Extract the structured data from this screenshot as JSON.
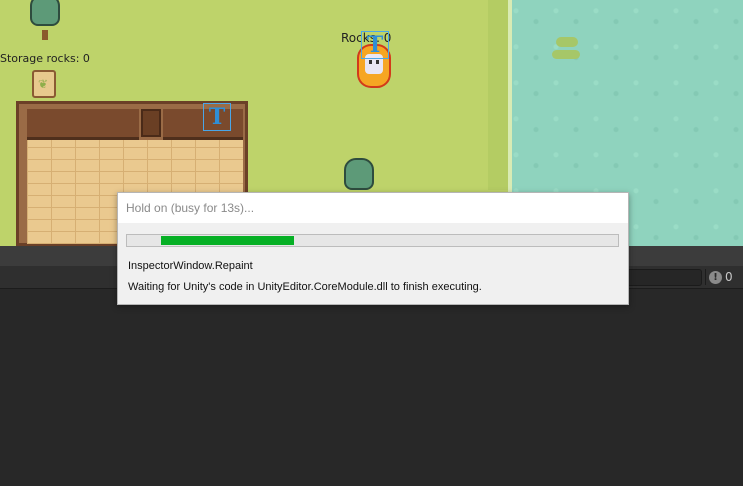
{
  "game": {
    "storage_label": "Storage rocks: 0",
    "rocks_label": "Rocks: 0",
    "gizmo_letter": "T",
    "sign_glyph": "❦"
  },
  "console": {
    "warning_icon": "!",
    "warning_count": "0"
  },
  "dialog": {
    "title": "Hold on (busy for 13s)...",
    "task": "InspectorWindow.Repaint",
    "message": "Waiting for Unity's code in UnityEditor.CoreModule.dll to finish executing.",
    "progress": 0.27,
    "progress_offset": 0.07,
    "progress_color": "#06b025"
  },
  "colors": {
    "grass": "#bed36a",
    "water": "#8fd3be",
    "editor_bg": "#282828"
  },
  "icons": [
    "tree-icon",
    "sign-icon",
    "player-icon",
    "text-gizmo-icon",
    "warning-icon"
  ]
}
